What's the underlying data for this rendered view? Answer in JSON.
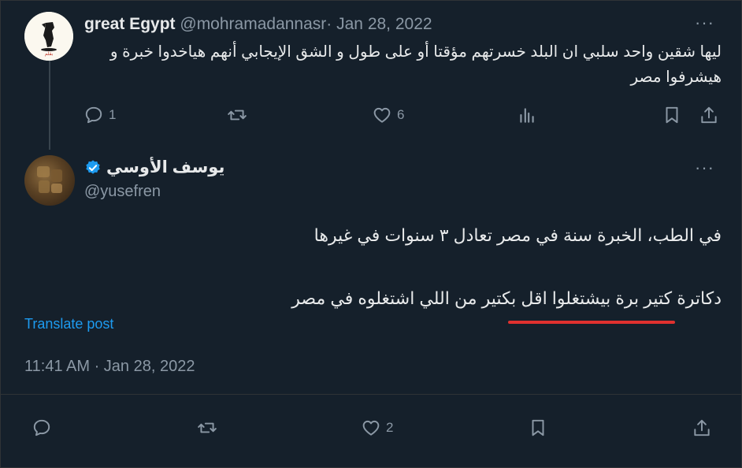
{
  "reply_tweet": {
    "display_name": "great Egypt",
    "handle": "@mohramadannasr",
    "date": "Jan 28, 2022",
    "text": "ليها شقين واحد سلبي ان البلد خسرتهم مؤقتا أو على طول و الشق الإيجابي أنهم هياخدوا خبرة و هيشرفوا مصر",
    "avatar_text": "بقلم",
    "more_label": "···",
    "actions": {
      "replies": "1",
      "likes": "6"
    }
  },
  "main_tweet": {
    "display_name": "يوسف الأوسي",
    "handle": "@yusefren",
    "verified": true,
    "more_label": "···",
    "text_line1": "في الطب، الخبرة سنة في مصر تعادل ٣ سنوات في غيرها",
    "text_line2": "دكاترة كتير برة بيشتغلوا اقل بكتير من اللي اشتغلوه في مصر",
    "translate_label": "Translate post",
    "timestamp": "11:41 AM · Jan 28, 2022",
    "actions": {
      "likes": "2"
    }
  },
  "colors": {
    "background": "#15202b",
    "text": "#e7e9ea",
    "muted": "#8b98a5",
    "link": "#1d9bf0",
    "verified": "#1d9bf0",
    "annotation_underline": "#e0312f"
  },
  "icons": [
    "reply-icon",
    "retweet-icon",
    "like-icon",
    "views-icon",
    "bookmark-icon",
    "share-icon",
    "verified-badge-icon"
  ]
}
